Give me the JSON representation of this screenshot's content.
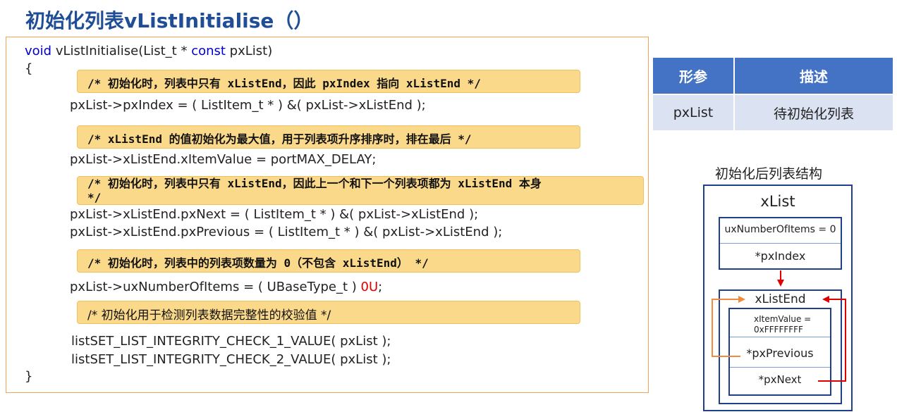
{
  "title": "初始化列表vListInitialise（）",
  "code": {
    "signature": {
      "kw_void": "void",
      "name": " vListInitialise(List_t * ",
      "kw_const": "const",
      "param": " pxList)"
    },
    "open_brace": "{",
    "close_brace": "}",
    "comment1": "/*  初始化时，列表中只有 xListEnd，因此 pxIndex 指向 xListEnd */",
    "line1": "pxList->pxIndex = ( ListItem_t * ) &( pxList->xListEnd );",
    "comment2": "/* xListEnd 的值初始化为最大值，用于列表项升序排序时，排在最后 */",
    "line2": "pxList->xListEnd.xItemValue = portMAX_DELAY;",
    "comment3a": "/* 初始化时，列表中只有 xListEnd，因此上一个和下一个列表项都为 xListEnd 本身",
    "comment3b": "*/",
    "line3": "pxList->xListEnd.pxNext = ( ListItem_t * ) &( pxList->xListEnd );",
    "line4": "pxList->xListEnd.pxPrevious = ( ListItem_t * ) &( pxList->xListEnd );",
    "comment4": "/* 初始化时，列表中的列表项数量为 0（不包含 xListEnd） */",
    "line5_pre": "pxList->uxNumberOfItems = ( UBaseType_t ) ",
    "line5_num": "0U",
    "line5_post": ";",
    "comment5": "/*  初始化用于检测列表数据完整性的校验值 */",
    "line6": "listSET_LIST_INTEGRITY_CHECK_1_VALUE( pxList );",
    "line7": "listSET_LIST_INTEGRITY_CHECK_2_VALUE( pxList );"
  },
  "param_table": {
    "headers": [
      "形参",
      "描述"
    ],
    "rows": [
      [
        "pxList",
        "待初始化列表"
      ]
    ]
  },
  "diagram": {
    "title": "初始化后列表结构",
    "list_label": "xList",
    "ux_number": "uxNumberOfItems = 0",
    "px_index": "*pxIndex",
    "list_end_label": "xListEnd",
    "item_value_1": "xItemValue =",
    "item_value_2": "0xFFFFFFFF",
    "px_previous": "*pxPrevious",
    "px_next": "*pxNext"
  },
  "colors": {
    "title": "#1f4e96",
    "comment_bg": "#fbd98a",
    "code_border": "#f0a35b",
    "table_header": "#4472c4",
    "table_cell": "#dbe3f2",
    "box_border": "#1f3f8a",
    "arrow_red": "#e00000",
    "arrow_orange": "#f08a3c"
  }
}
